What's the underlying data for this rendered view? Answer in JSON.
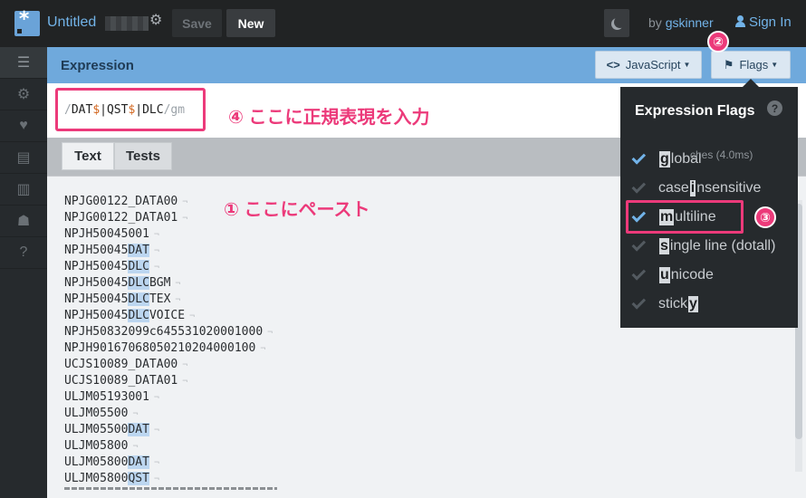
{
  "topbar": {
    "title": "Untitled",
    "save_label": "Save",
    "new_label": "New",
    "by_prefix": "by",
    "by_user": "gskinner",
    "signin_label": "Sign In"
  },
  "sidebar": {
    "items": [
      {
        "icon": "list-icon",
        "glyph": "☰"
      },
      {
        "icon": "settings-gear-icon",
        "glyph": "⚙"
      },
      {
        "icon": "heart-icon",
        "glyph": "♥"
      },
      {
        "icon": "document-icon",
        "glyph": "▤"
      },
      {
        "icon": "book-icon",
        "glyph": "▥"
      },
      {
        "icon": "community-icon",
        "glyph": "☗"
      },
      {
        "icon": "help-icon",
        "glyph": "?"
      }
    ]
  },
  "expression": {
    "header_label": "Expression",
    "language_label": "JavaScript",
    "flags_label": "Flags",
    "pattern": {
      "open_slash": "/",
      "part1": "DAT",
      "dollar": "$",
      "pipe": "|",
      "part2": "QST",
      "part3": "DLC",
      "close_slash": "/",
      "flags": "gm"
    },
    "annotation": "④ ここに正規表現を入力"
  },
  "tabs": {
    "text_label": "Text",
    "tests_label": "Tests"
  },
  "text_area": {
    "annotation": "① ここにペースト",
    "lines": [
      {
        "plain": "NPJG00122_DATA00",
        "match": ""
      },
      {
        "plain": "NPJG00122_DATA01",
        "match": ""
      },
      {
        "plain": "NPJH50045001",
        "match": ""
      },
      {
        "plain": "NPJH50045",
        "match": "DAT"
      },
      {
        "plain": "NPJH50045",
        "match": "DLC"
      },
      {
        "plain": "NPJH50045",
        "match": "DLC",
        "after": "BGM"
      },
      {
        "plain": "NPJH50045",
        "match": "DLC",
        "after": "TEX"
      },
      {
        "plain": "NPJH50045",
        "match": "DLC",
        "after": "VOICE"
      },
      {
        "plain": "NPJH50832099c645531020001000",
        "match": ""
      },
      {
        "plain": "NPJH90167068050210204000100",
        "match": ""
      },
      {
        "plain": "UCJS10089_DATA00",
        "match": ""
      },
      {
        "plain": "UCJS10089_DATA01",
        "match": ""
      },
      {
        "plain": "ULJM05193001",
        "match": ""
      },
      {
        "plain": "ULJM05500",
        "match": ""
      },
      {
        "plain": "ULJM05500",
        "match": "DAT"
      },
      {
        "plain": "ULJM05800",
        "match": ""
      },
      {
        "plain": "ULJM05800",
        "match": "DAT"
      },
      {
        "plain": "ULJM05800",
        "match": "QST"
      }
    ]
  },
  "flags_panel": {
    "title": "Expression Flags",
    "ghost_text": "ches (4.0ms)",
    "items": [
      {
        "before": "",
        "key": "g",
        "after": "lobal",
        "checked": true
      },
      {
        "before": "case ",
        "key": "i",
        "after": "nsensitive",
        "checked": false
      },
      {
        "before": "",
        "key": "m",
        "after": "ultiline",
        "checked": true
      },
      {
        "before": "",
        "key": "s",
        "after": "ingle line (dotall)",
        "checked": false
      },
      {
        "before": "",
        "key": "u",
        "after": "nicode",
        "checked": false
      },
      {
        "before": "stick",
        "key": "y",
        "after": "",
        "checked": false
      }
    ]
  },
  "badges": {
    "two": "②",
    "three": "③"
  },
  "colors": {
    "accent_blue": "#6fa9dc",
    "link_blue": "#72b3e8",
    "annotation_pink": "#ec3a7a",
    "match_highlight": "#bcd6f0"
  }
}
